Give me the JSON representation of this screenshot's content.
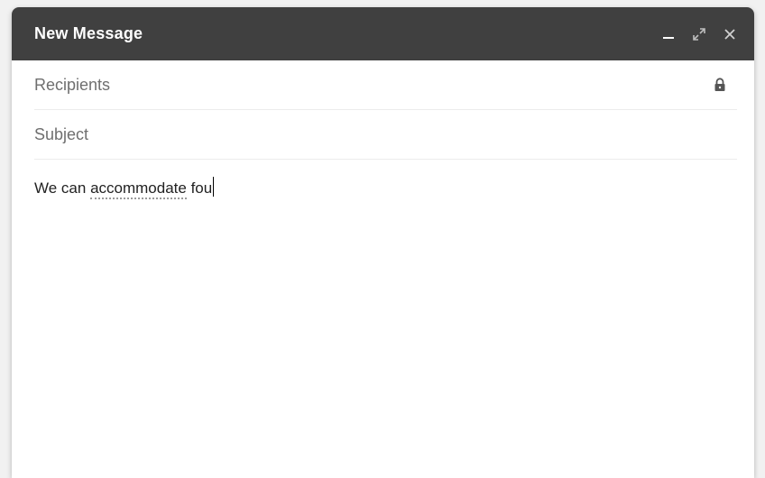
{
  "compose": {
    "title": "New Message",
    "window_controls": {
      "minimize_icon": "minimize-icon",
      "expand_icon": "expand-icon",
      "close_icon": "close-icon"
    },
    "recipients": {
      "placeholder": "Recipients",
      "value": "",
      "lock_icon": "lock-icon"
    },
    "subject": {
      "placeholder": "Subject",
      "value": ""
    },
    "body": {
      "text_before": "We can ",
      "misspelled_word": "accommodate",
      "text_after": " fou"
    }
  },
  "colors": {
    "titlebar_bg": "#404040",
    "title_text": "#ffffff",
    "divider": "#ececec",
    "placeholder": "#6f6f6f"
  }
}
